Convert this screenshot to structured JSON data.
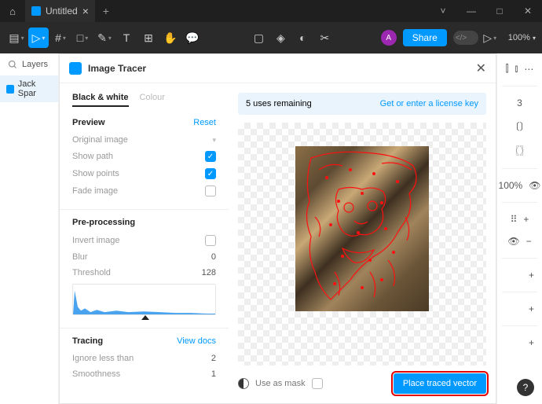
{
  "titlebar": {
    "doc_title": "Untitled"
  },
  "toolbar": {
    "avatar": "A",
    "share": "Share",
    "zoom": "100%"
  },
  "left": {
    "layers_label": "Layers",
    "layer1": "Jack Spar"
  },
  "right": {
    "val1": "3",
    "pct": "100%"
  },
  "modal": {
    "title": "Image Tracer",
    "tabs": {
      "bw": "Black & white",
      "colour": "Colour"
    },
    "license": {
      "uses": "5 uses remaining",
      "link": "Get or enter a license key"
    },
    "preview": {
      "heading": "Preview",
      "reset": "Reset",
      "original": "Original image",
      "show_path": "Show path",
      "show_points": "Show points",
      "fade": "Fade image"
    },
    "preproc": {
      "heading": "Pre-processing",
      "invert": "Invert image",
      "blur": "Blur",
      "blur_v": "0",
      "threshold": "Threshold",
      "threshold_v": "128"
    },
    "tracing": {
      "heading": "Tracing",
      "docs": "View docs",
      "ignore": "Ignore less than",
      "ignore_v": "2",
      "smooth": "Smoothness",
      "smooth_v": "1"
    },
    "footer": {
      "mask": "Use as mask",
      "place": "Place traced vector"
    }
  }
}
